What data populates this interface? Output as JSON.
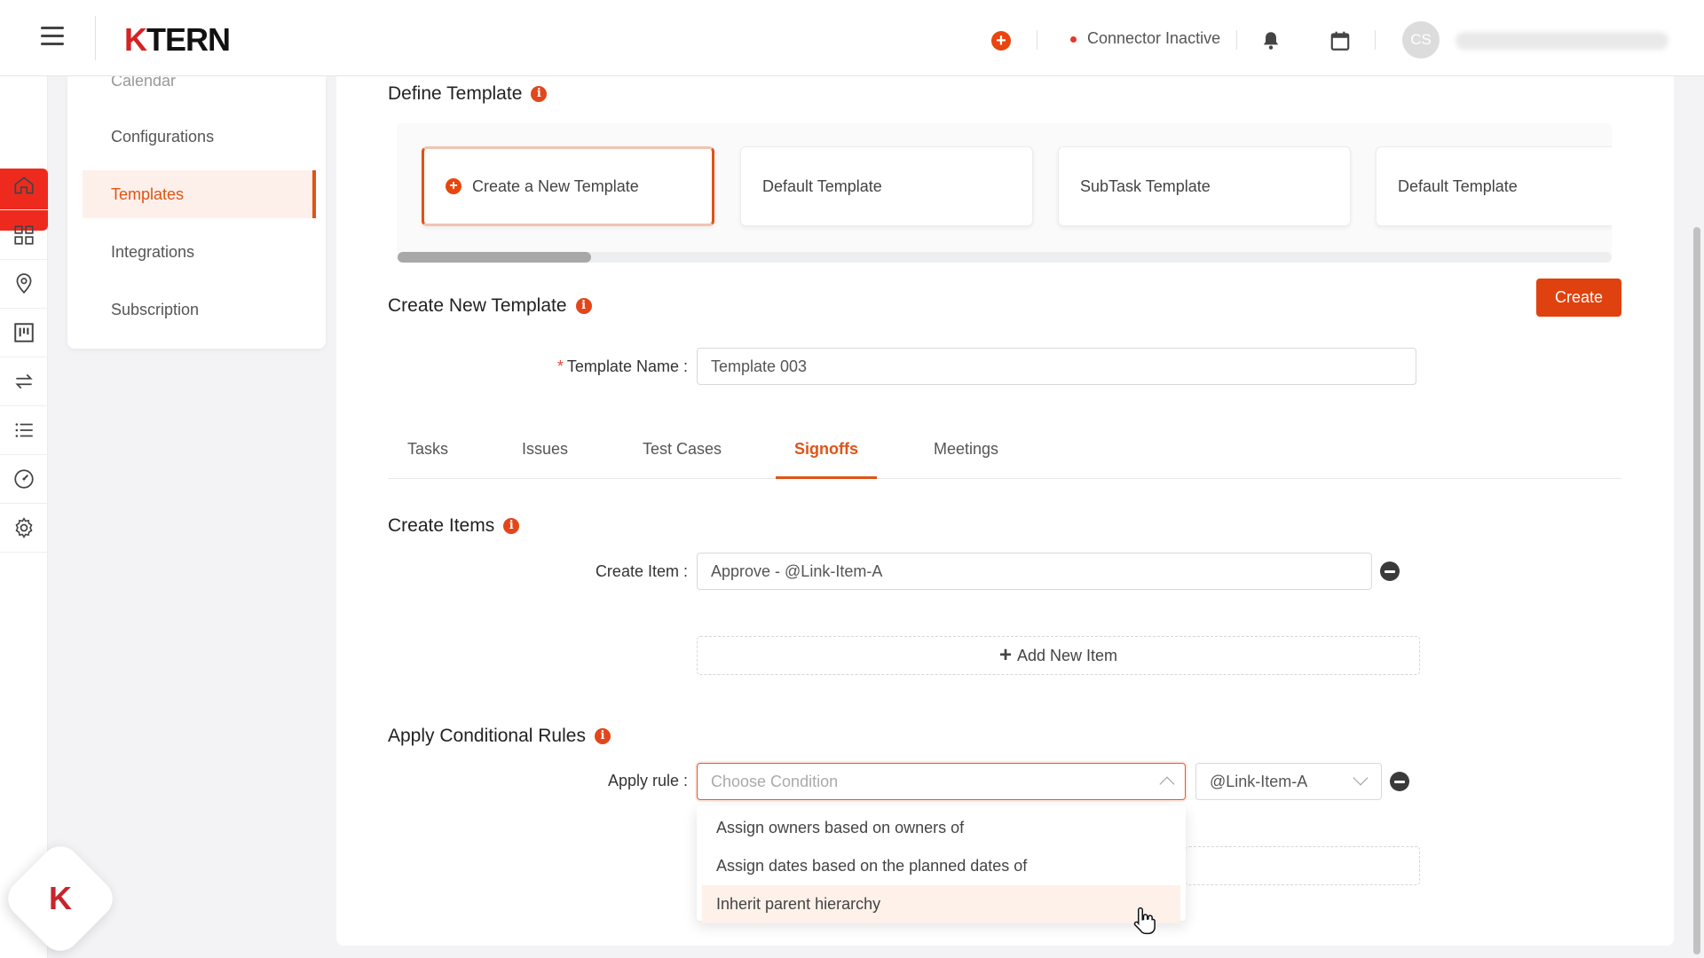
{
  "header": {
    "logo_text": "TERN",
    "logo_k": "K",
    "connector_status": "Connector Inactive",
    "avatar_initials": "CS"
  },
  "settings_menu": {
    "items": [
      {
        "label": "Calendar"
      },
      {
        "label": "Configurations"
      },
      {
        "label": "Templates",
        "active": true
      },
      {
        "label": "Integrations"
      },
      {
        "label": "Subscription"
      }
    ]
  },
  "define_template": {
    "title": "Define Template",
    "cards": [
      {
        "label": "Create a New Template",
        "selected": true
      },
      {
        "label": "Default Template"
      },
      {
        "label": "SubTask Template"
      },
      {
        "label": "Default Template"
      }
    ]
  },
  "create_template": {
    "title": "Create New Template",
    "create_button": "Create",
    "name_label": "Template Name",
    "name_value": "Template 003"
  },
  "tabs": [
    {
      "label": "Tasks"
    },
    {
      "label": "Issues"
    },
    {
      "label": "Test Cases"
    },
    {
      "label": "Signoffs",
      "active": true
    },
    {
      "label": "Meetings"
    }
  ],
  "create_items": {
    "title": "Create Items",
    "item_label": "Create Item",
    "item_value": "Approve - @Link-Item-A",
    "add_button": "Add New Item"
  },
  "conditional_rules": {
    "title": "Apply Conditional Rules",
    "rule_label": "Apply rule",
    "condition_placeholder": "Choose Condition",
    "link_value": "@Link-Item-A",
    "options": [
      {
        "label": "Assign owners based on owners of"
      },
      {
        "label": "Assign dates based on the planned dates of"
      },
      {
        "label": "Inherit parent hierarchy",
        "hovered": true
      }
    ]
  },
  "colors": {
    "accent": "#e05316",
    "brand_red": "#ee2a1f"
  },
  "rail_icons": [
    "home-icon",
    "dashboard-grid-icon",
    "location-pin-icon",
    "board-icon",
    "arrows-exchange-icon",
    "list-icon",
    "speedometer-icon",
    "settings-gear-icon"
  ]
}
